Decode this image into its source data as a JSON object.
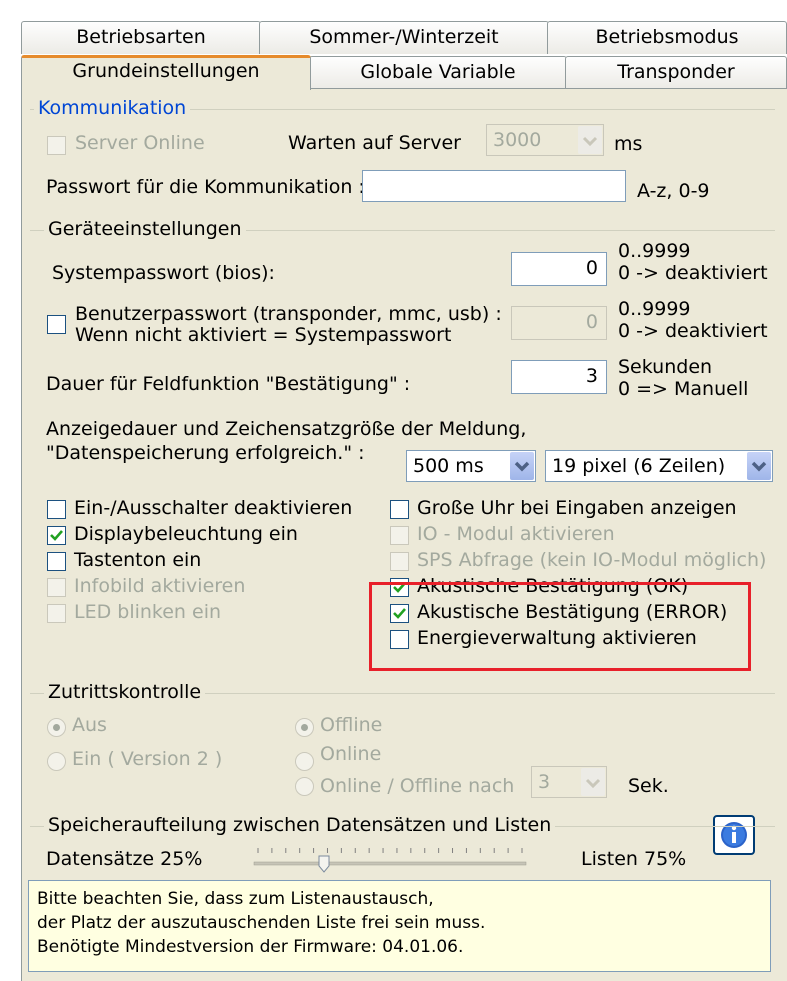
{
  "tabs_row1": [
    "Betriebsarten",
    "Sommer-/Winterzeit",
    "Betriebsmodus"
  ],
  "tabs_row2": [
    "Grundeinstellungen",
    "Globale Variable",
    "Transponder"
  ],
  "kommunikation": {
    "title": "Kommunikation",
    "server_online": "Server Online",
    "warten_label": "Warten auf Server",
    "warten_value": "3000",
    "ms": "ms",
    "passwort_label": "Passwort für die Kommunikation :",
    "passwort_value": "",
    "passwort_hint": "A-z, 0-9"
  },
  "geraete": {
    "title": "Geräteeinstellungen",
    "systempasswort_label": "Systempasswort (bios):",
    "systempasswort_value": "0",
    "range1_a": "0..9999",
    "range1_b": "0 -> deaktiviert",
    "benutzer_line1": "Benutzerpasswort (transponder, mmc, usb) :",
    "benutzer_line2": "Wenn nicht aktiviert = Systempasswort",
    "benutzer_value": "0",
    "range2_a": "0..9999",
    "range2_b": "0 -> deaktiviert",
    "dauer_label": "Dauer für Feldfunktion \"Bestätigung\" :",
    "dauer_value": "3",
    "sek_a": "Sekunden",
    "sek_b": "0 => Manuell",
    "anzeige_line1": "Anzeigedauer und Zeichensatzgröße der Meldung,",
    "anzeige_line2": "\"Datenspeicherung erfolgreich.\" :",
    "anzeige_ms": "500 ms",
    "anzeige_pixel": "19 pixel (6 Zeilen)"
  },
  "checks_left": [
    {
      "label": "Ein-/Ausschalter deaktivieren",
      "checked": false,
      "enabled": true
    },
    {
      "label": "Displaybeleuchtung ein",
      "checked": true,
      "enabled": true
    },
    {
      "label": "Tastenton ein",
      "checked": false,
      "enabled": true
    },
    {
      "label": "Infobild aktivieren",
      "checked": false,
      "enabled": false
    },
    {
      "label": "LED blinken ein",
      "checked": false,
      "enabled": false
    }
  ],
  "checks_right": [
    {
      "label": "Große Uhr bei Eingaben anzeigen",
      "checked": false,
      "enabled": true
    },
    {
      "label": "IO - Modul aktivieren",
      "checked": false,
      "enabled": false
    },
    {
      "label": "SPS Abfrage (kein IO-Modul möglich)",
      "checked": false,
      "enabled": false
    },
    {
      "label": "Akustische Bestätigung (OK)",
      "checked": true,
      "enabled": true
    },
    {
      "label": "Akustische Bestätigung (ERROR)",
      "checked": true,
      "enabled": true
    },
    {
      "label": "Energieverwaltung aktivieren",
      "checked": false,
      "enabled": true
    }
  ],
  "zutritt": {
    "title": "Zutrittskontrolle",
    "aus": "Aus",
    "ein": "Ein ( Version 2 )",
    "offline": "Offline",
    "online": "Online",
    "online_offline": "Online / Offline nach",
    "nach_value": "3",
    "sek": "Sek."
  },
  "speicher": {
    "title": "Speicheraufteilung zwischen Datensätzen und Listen",
    "left": "Datensätze 25%",
    "right": "Listen 75%",
    "slider_fraction": 0.25,
    "note1": "Bitte beachten Sie, dass zum Listenaustausch,",
    "note2": "der Platz der auszutauschenden Liste frei sein muss.",
    "note3": "Benötigte Mindestversion der Firmware: 04.01.06."
  },
  "colors": {
    "panel": "#ece9d8",
    "highlight": "#e8202a",
    "check": "#21a121",
    "note_bg": "#ffffe1"
  }
}
